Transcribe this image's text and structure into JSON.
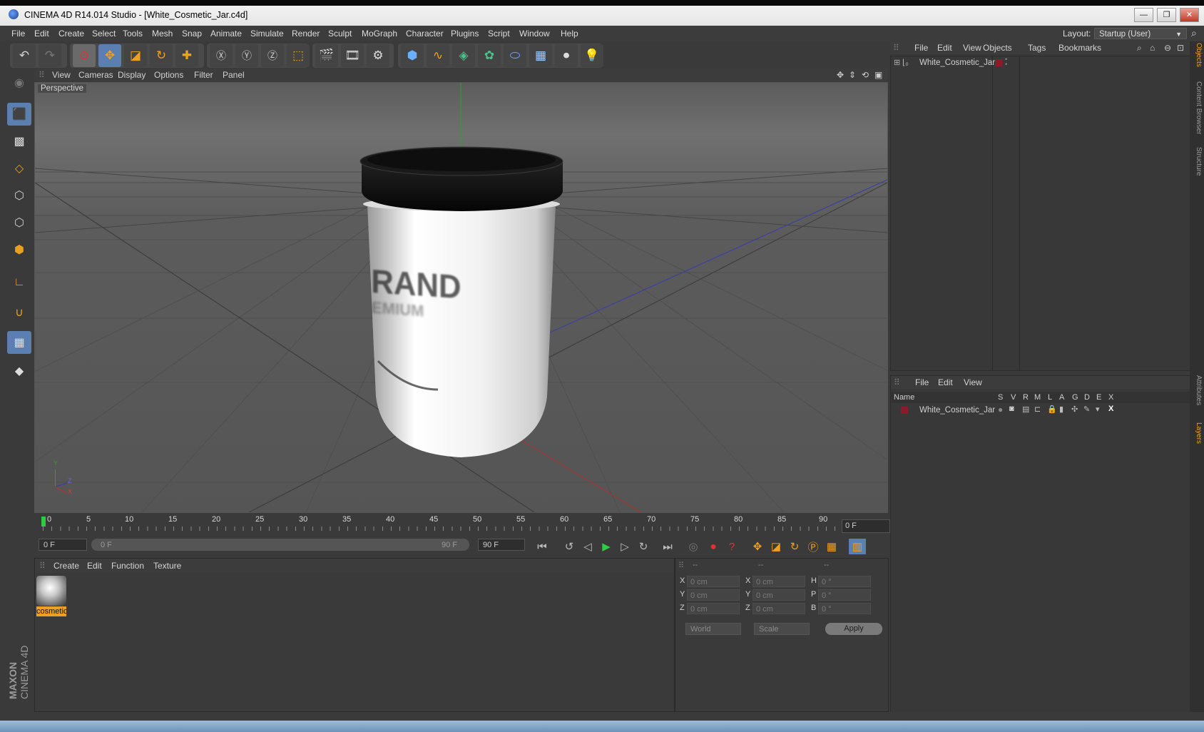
{
  "window": {
    "title": "CINEMA 4D R14.014 Studio - [White_Cosmetic_Jar.c4d]",
    "minimize": "—",
    "maximize": "❐",
    "close": "✕"
  },
  "menubar": {
    "items": [
      "File",
      "Edit",
      "Create",
      "Select",
      "Tools",
      "Mesh",
      "Snap",
      "Animate",
      "Simulate",
      "Render",
      "Sculpt",
      "MoGraph",
      "Character",
      "Plugins",
      "Script",
      "Window",
      "Help"
    ],
    "layout_label": "Layout:",
    "layout_value": "Startup (User)"
  },
  "viewport": {
    "menu": [
      "View",
      "Cameras",
      "Display",
      "Options",
      "Filter",
      "Panel"
    ],
    "camera_label": "Perspective",
    "jar_brand_text": "RAND",
    "jar_sub_text": "EMIUM",
    "axis_y": "Y",
    "axis_z": "Z",
    "axis_x": "X"
  },
  "timeline": {
    "ticks": [
      "0",
      "5",
      "10",
      "15",
      "20",
      "25",
      "30",
      "35",
      "40",
      "45",
      "50",
      "55",
      "60",
      "65",
      "70",
      "75",
      "80",
      "85",
      "90"
    ],
    "current_frame": "0 F",
    "start_field": "0 F",
    "slider_start": "0 F",
    "slider_end": "90 F",
    "end_field": "90 F"
  },
  "material_manager": {
    "menu": [
      "Create",
      "Edit",
      "Function",
      "Texture"
    ],
    "material_name": "cosmetic"
  },
  "coordinates": {
    "col_headers": [
      "--",
      "--",
      "--"
    ],
    "rows": [
      {
        "l1": "X",
        "v1": "0 cm",
        "l2": "X",
        "v2": "0 cm",
        "l3": "H",
        "v3": "0 °"
      },
      {
        "l1": "Y",
        "v1": "0 cm",
        "l2": "Y",
        "v2": "0 cm",
        "l3": "P",
        "v3": "0 °"
      },
      {
        "l1": "Z",
        "v1": "0 cm",
        "l2": "Z",
        "v2": "0 cm",
        "l3": "B",
        "v3": "0 °"
      }
    ],
    "mode1": "World",
    "mode2": "Scale",
    "apply": "Apply"
  },
  "object_manager": {
    "menu": [
      "File",
      "Edit",
      "View",
      "Objects",
      "Tags",
      "Bookmarks"
    ],
    "object_name": "White_Cosmetic_Jar"
  },
  "layer_manager": {
    "menu": [
      "File",
      "Edit",
      "View"
    ],
    "columns": [
      "Name",
      "S",
      "V",
      "R",
      "M",
      "L",
      "A",
      "G",
      "D",
      "E",
      "X"
    ],
    "layer_name": "White_Cosmetic_Jar"
  },
  "side_tabs": [
    "Objects",
    "Content Browser",
    "Structure",
    "Attributes",
    "Layers"
  ],
  "branding": {
    "maxon": "MAXON",
    "product": "CINEMA 4D"
  },
  "colors": {
    "accent": "#f0a020",
    "layer": "#8b1a2b"
  }
}
